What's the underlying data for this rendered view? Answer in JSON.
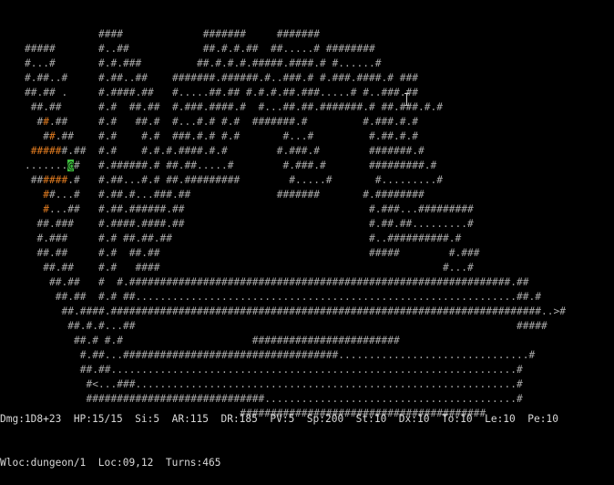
{
  "map_rows": [
    "                ####             #######     #######",
    "    #####       #..##            ##.#.#.##  ##.....# ########",
    "    #...#       #.#.###         ##.#.#.#.#####.####.# #......#",
    "    #.##..#     #.##..##    #######.######.#..###.# #.###.####.# ###",
    "    ##.## .     #.####.##   #.....##.## #.#.#.##.###.....# #..###.##",
    "     ##.##      #.#  ##.##  #.###.####.#  #...##.##.#######.# ##.###.#.#",
    "      ##.##     #.#   ##.#  #...#.# #.#  #######.#         #.###.#.#",
    "       ##.##    #.#    #.#  ###.#.# #.#       #...#         #.##.#.#",
    "     ######.##  #.#    #.#.#.####.#.#        #.###.#        #######.#",
    "    .......@#   #.######.# ##.##.....#        #.###.#       #########.#",
    "     ######.#   #.##...#.# ##.#########        #.....#       #.........#",
    "       ##...#   #.##.#...###.##              #######       #.########",
    "       #...##   #.##.######.##                              #.###...#########",
    "      ##.###    #.####.####.##                              #.##.##.........#",
    "      #.###     #.# ##.##.##                                #..##########.#",
    "      ##.##     #.#  ##.##                                  #####        #.###",
    "       ##.##    #.#   ####                                              #...#",
    "        ##.##   #  #.##############################################################.##",
    "         ##.##  #.# ##..............................................................##.#",
    "          ##.####.######################################################################..>#",
    "           ##.#.#...##                                                              #####",
    "            ##.# #.#                     ########################",
    "             #.##...###################################...............................#",
    "             ##.##..................................................................#",
    "              #<...###..............................................................#",
    "              #############################.........................................#",
    "                                       ########################################"
  ],
  "status_line1": "Dmg:1D8+23  HP:15/15  Si:5  AR:115  DR:185  PV:5  Sp:200  St:10  Dx:10  To:10  Le:10  Pe:10",
  "status_line2": "Wloc:dungeon/1  Loc:09,12  Turns:465",
  "colors": {
    "background": "#000000",
    "wall": "#a8a8a8",
    "lit_wall": "#e07b20",
    "player_bg": "#3fbf3f"
  },
  "icons": {
    "player": "player-icon (@)",
    "stairs_down": "stairs-down-icon (>)",
    "stairs_up": "stairs-up-icon (<)"
  }
}
